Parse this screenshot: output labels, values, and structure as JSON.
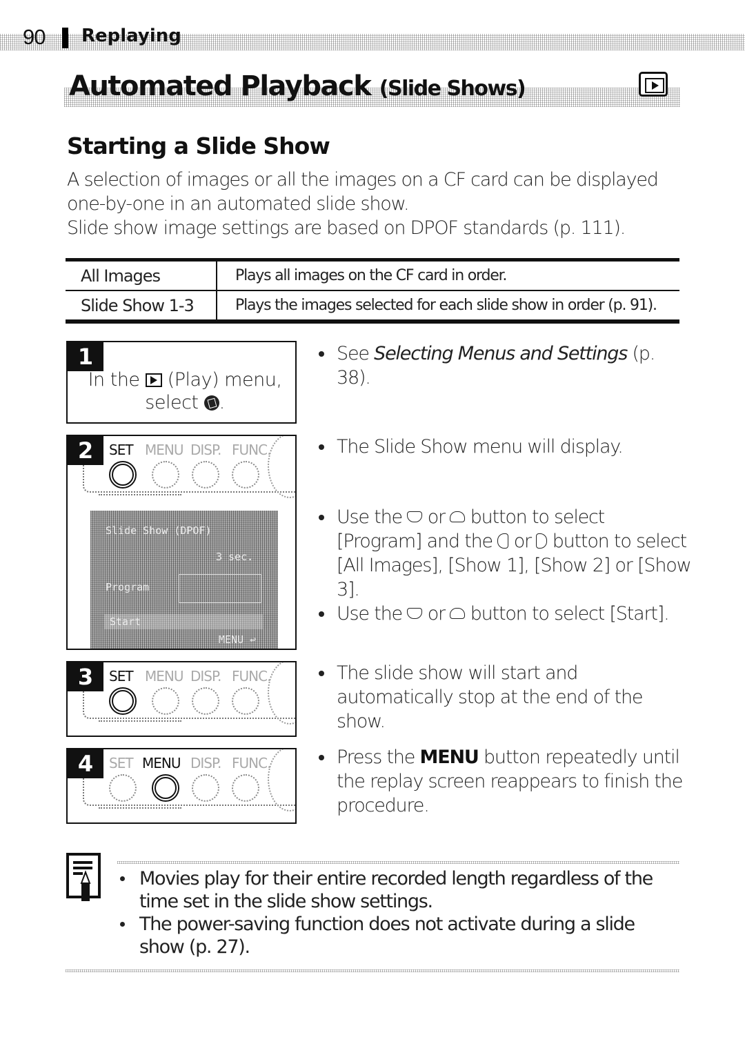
{
  "header": {
    "page_number": "90",
    "section": "Replaying"
  },
  "title": {
    "main": "Automated Playback ",
    "sub": "(Slide Shows)",
    "mode_icon": "play-mode-icon"
  },
  "subheading": "Starting a Slide Show",
  "intro": [
    "A selection of images or all the images on a CF card can be displayed one-by-one in an automated slide show.",
    "Slide show image settings are based on DPOF standards (p. 111)."
  ],
  "table": {
    "rows": [
      {
        "option": "All Images",
        "description": "Plays all images on the CF card in order."
      },
      {
        "option": "Slide Show 1-3",
        "description": "Plays the images selected for each slide show in order (p. 91)."
      }
    ]
  },
  "steps": [
    {
      "number": "1",
      "text_a": "In the ",
      "text_b": " (Play) menu,",
      "text_c": "select ",
      "text_d": "."
    },
    {
      "number": "2",
      "highlight": "SET"
    },
    {
      "number": "3",
      "highlight": "SET"
    },
    {
      "number": "4",
      "highlight": "MENU"
    }
  ],
  "camera_buttons": [
    "SET",
    "MENU",
    "DISP.",
    "FUNC."
  ],
  "lcd": {
    "title": "Slide Show (DPOF)",
    "interval": "3 sec.",
    "program_label": "Program",
    "start_label": "Start",
    "menu_label": "MENU ↩"
  },
  "bullets": {
    "b1": {
      "pre": "See ",
      "italic": "Selecting Menus and Settings",
      "post": " (p. 38)."
    },
    "b2": "The Slide Show menu will display.",
    "b3": {
      "a": "Use the ",
      "b": " or ",
      "c": " button to select [Program] and the ",
      "d": " or ",
      "e": " button to select [All Images], [Show 1], [Show 2] or [Show 3]."
    },
    "b4": {
      "a": "Use the ",
      "b": " or ",
      "c": " button to select [Start]."
    },
    "b5": "The slide show will start and automatically stop at the end of the show.",
    "b6": {
      "pre": "Press the ",
      "bold": "MENU",
      "post": " button repeatedly until the replay screen reappears to finish the procedure."
    }
  },
  "note": {
    "icon": "note-pencil-icon",
    "items": [
      "Movies play for their entire recorded length regardless of the time set in the slide show settings.",
      "The power-saving function does not activate during a slide show (p. 27)."
    ]
  }
}
